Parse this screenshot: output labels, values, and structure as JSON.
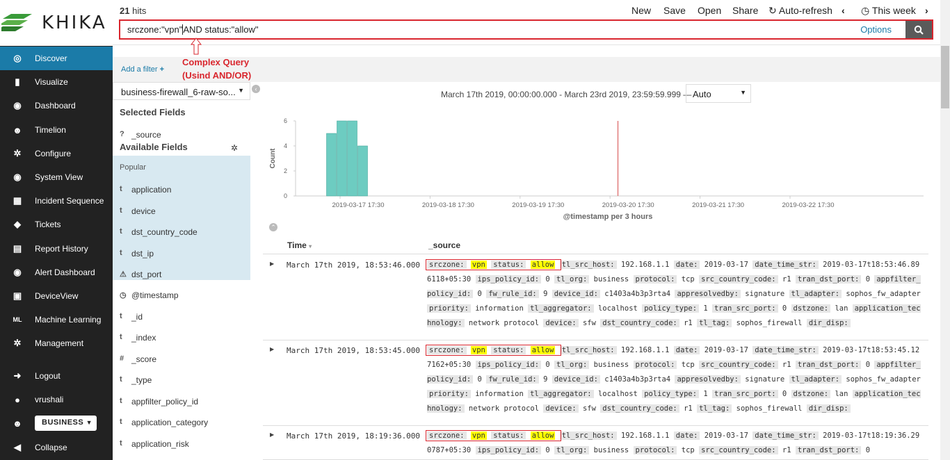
{
  "logo": {
    "text": "KHIKA"
  },
  "nav": {
    "items": [
      {
        "label": "Discover",
        "icon": "compass-icon",
        "glyph": "◎"
      },
      {
        "label": "Visualize",
        "icon": "bar-chart-icon",
        "glyph": "▮"
      },
      {
        "label": "Dashboard",
        "icon": "dashboard-icon",
        "glyph": "◉"
      },
      {
        "label": "Timelion",
        "icon": "timelion-icon",
        "glyph": "☻"
      },
      {
        "label": "Configure",
        "icon": "gear-icon",
        "glyph": "✲"
      },
      {
        "label": "System View",
        "icon": "eye-icon",
        "glyph": "◉"
      },
      {
        "label": "Incident Sequence",
        "icon": "sequence-icon",
        "glyph": "▦"
      },
      {
        "label": "Tickets",
        "icon": "ticket-icon",
        "glyph": "◆"
      },
      {
        "label": "Report History",
        "icon": "report-icon",
        "glyph": "▤"
      },
      {
        "label": "Alert Dashboard",
        "icon": "alert-dashboard-icon",
        "glyph": "◉"
      },
      {
        "label": "DeviceView",
        "icon": "device-icon",
        "glyph": "▣"
      },
      {
        "label": "Machine Learning",
        "icon": "ml-icon",
        "glyph": "ML"
      },
      {
        "label": "Management",
        "icon": "gear-icon",
        "glyph": "✲"
      },
      {
        "label": "Logout",
        "icon": "logout-icon",
        "glyph": "➜"
      },
      {
        "label": "vrushali",
        "icon": "user-icon",
        "glyph": "●"
      },
      {
        "label": "",
        "icon": "users-icon",
        "glyph": "☻"
      },
      {
        "label": "Collapse",
        "icon": "collapse-icon",
        "glyph": "◀"
      }
    ],
    "tenant": "BUSINESS"
  },
  "topbar": {
    "hits_count": "21",
    "hits_label": "hits",
    "new": "New",
    "save": "Save",
    "open": "Open",
    "share": "Share",
    "autorefresh": "Auto-refresh",
    "timerange": "This week"
  },
  "query": {
    "part1": "srczone:\"vpn\"",
    "part2": "AND status:\"allow\"",
    "options": "Options"
  },
  "filter": {
    "add": "Add a filter"
  },
  "annotation": {
    "line1": "Complex Query",
    "line2": "(Usind AND/OR)"
  },
  "sidebar": {
    "index_pattern": "business-firewall_6-raw-so...",
    "selected_title": "Selected Fields",
    "selected": [
      {
        "type": "?",
        "name": "_source"
      }
    ],
    "available_title": "Available Fields",
    "popular_title": "Popular",
    "popular": [
      {
        "type": "t",
        "name": "application"
      },
      {
        "type": "t",
        "name": "device"
      },
      {
        "type": "t",
        "name": "dst_country_code"
      },
      {
        "type": "t",
        "name": "dst_ip"
      },
      {
        "type": "⚠",
        "name": "dst_port"
      }
    ],
    "others": [
      {
        "type": "◷",
        "name": "@timestamp"
      },
      {
        "type": "t",
        "name": "_id"
      },
      {
        "type": "t",
        "name": "_index"
      },
      {
        "type": "#",
        "name": "_score"
      },
      {
        "type": "t",
        "name": "_type"
      },
      {
        "type": "t",
        "name": "appfilter_policy_id"
      },
      {
        "type": "t",
        "name": "application_category"
      },
      {
        "type": "t",
        "name": "application_risk"
      }
    ]
  },
  "histogram": {
    "range": "March 17th 2019, 00:00:00.000 - March 23rd 2019, 23:59:59.999 —",
    "interval": "Auto"
  },
  "chart_data": {
    "type": "bar",
    "ylabel": "Count",
    "xlabel": "@timestamp per 3 hours",
    "ylim": [
      0,
      6
    ],
    "yticks": [
      0,
      2,
      4,
      6
    ],
    "xticks": [
      "2019-03-17 17:30",
      "2019-03-18 17:30",
      "2019-03-19 17:30",
      "2019-03-20 17:30",
      "2019-03-21 17:30",
      "2019-03-22 17:30"
    ],
    "categories": [
      "2019-03-17 12:00",
      "2019-03-17 15:00",
      "2019-03-17 18:00",
      "2019-03-17 21:00"
    ],
    "values": [
      5,
      6,
      6,
      4
    ],
    "bar_color": "#6dccc1",
    "now_marker_color": "#e07b7b"
  },
  "table": {
    "col_time": "Time",
    "col_source": "_source",
    "rows": [
      {
        "time": "March 17th 2019, 18:53:46.000",
        "fields": [
          [
            "srczone:",
            "vpn",
            true
          ],
          [
            "status:",
            "allow",
            true
          ],
          [
            "tl_src_host:",
            "192.168.1.1",
            false
          ],
          [
            "date:",
            "2019-03-17",
            false
          ],
          [
            "date_time_str:",
            "2019-03-17t18:53:46.896118+05:30",
            false
          ],
          [
            "ips_policy_id:",
            "0",
            false
          ],
          [
            "tl_org:",
            "business",
            false
          ],
          [
            "protocol:",
            "tcp",
            false
          ],
          [
            "src_country_code:",
            "r1",
            false
          ],
          [
            "tran_dst_port:",
            "0",
            false
          ],
          [
            "appfilter_policy_id:",
            "0",
            false
          ],
          [
            "fw_rule_id:",
            "9",
            false
          ],
          [
            "device_id:",
            "c1403a4b3p3rta4",
            false
          ],
          [
            "appresolvedby:",
            "signature",
            false
          ],
          [
            "tl_adapter:",
            "sophos_fw_adapter",
            false
          ],
          [
            "priority:",
            "information",
            false
          ],
          [
            "tl_aggregator:",
            "localhost",
            false
          ],
          [
            "policy_type:",
            "1",
            false
          ],
          [
            "tran_src_port:",
            "0",
            false
          ],
          [
            "dstzone:",
            "lan",
            false
          ],
          [
            "application_technology:",
            "network protocol",
            false
          ],
          [
            "device:",
            "sfw",
            false
          ],
          [
            "dst_country_code:",
            "r1",
            false
          ],
          [
            "tl_tag:",
            "sophos_firewall",
            false
          ],
          [
            "dir_disp:",
            "",
            false
          ]
        ]
      },
      {
        "time": "March 17th 2019, 18:53:45.000",
        "fields": [
          [
            "srczone:",
            "vpn",
            true
          ],
          [
            "status:",
            "allow",
            true
          ],
          [
            "tl_src_host:",
            "192.168.1.1",
            false
          ],
          [
            "date:",
            "2019-03-17",
            false
          ],
          [
            "date_time_str:",
            "2019-03-17t18:53:45.127162+05:30",
            false
          ],
          [
            "ips_policy_id:",
            "0",
            false
          ],
          [
            "tl_org:",
            "business",
            false
          ],
          [
            "protocol:",
            "tcp",
            false
          ],
          [
            "src_country_code:",
            "r1",
            false
          ],
          [
            "tran_dst_port:",
            "0",
            false
          ],
          [
            "appfilter_policy_id:",
            "0",
            false
          ],
          [
            "fw_rule_id:",
            "9",
            false
          ],
          [
            "device_id:",
            "c1403a4b3p3rta4",
            false
          ],
          [
            "appresolvedby:",
            "signature",
            false
          ],
          [
            "tl_adapter:",
            "sophos_fw_adapter",
            false
          ],
          [
            "priority:",
            "information",
            false
          ],
          [
            "tl_aggregator:",
            "localhost",
            false
          ],
          [
            "policy_type:",
            "1",
            false
          ],
          [
            "tran_src_port:",
            "0",
            false
          ],
          [
            "dstzone:",
            "lan",
            false
          ],
          [
            "application_technology:",
            "network protocol",
            false
          ],
          [
            "device:",
            "sfw",
            false
          ],
          [
            "dst_country_code:",
            "r1",
            false
          ],
          [
            "tl_tag:",
            "sophos_firewall",
            false
          ],
          [
            "dir_disp:",
            "",
            false
          ]
        ]
      },
      {
        "time": "March 17th 2019, 18:19:36.000",
        "fields": [
          [
            "srczone:",
            "vpn",
            true
          ],
          [
            "status:",
            "allow",
            true
          ],
          [
            "tl_src_host:",
            "192.168.1.1",
            false
          ],
          [
            "date:",
            "2019-03-17",
            false
          ],
          [
            "date_time_str:",
            "2019-03-17t18:19:36.290787+05:30",
            false
          ],
          [
            "ips_policy_id:",
            "0",
            false
          ],
          [
            "tl_org:",
            "business",
            false
          ],
          [
            "protocol:",
            "tcp",
            false
          ],
          [
            "src_country_code:",
            "r1",
            false
          ],
          [
            "tran_dst_port:",
            "0",
            false
          ]
        ]
      }
    ]
  }
}
